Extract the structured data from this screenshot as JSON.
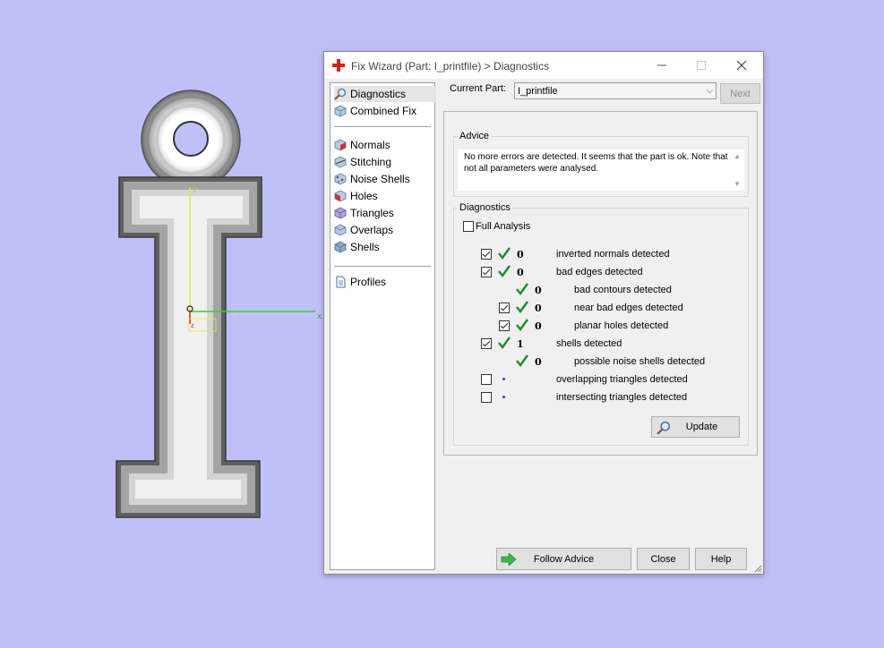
{
  "window": {
    "title": "Fix Wizard (Part: I_printfile) > Diagnostics",
    "minimize_icon": "minimize-icon",
    "maximize_icon": "maximize-icon",
    "close_icon": "close-icon"
  },
  "sidebar": {
    "items": [
      {
        "label": "Diagnostics",
        "icon": "magnifier-icon",
        "selected": true
      },
      {
        "label": "Combined Fix",
        "icon": "cube-icon"
      },
      {
        "label": "Normals",
        "icon": "normals-cube-icon"
      },
      {
        "label": "Stitching",
        "icon": "stitching-cube-icon"
      },
      {
        "label": "Noise Shells",
        "icon": "noise-shells-icon"
      },
      {
        "label": "Holes",
        "icon": "holes-cube-icon"
      },
      {
        "label": "Triangles",
        "icon": "triangles-cube-icon"
      },
      {
        "label": "Overlaps",
        "icon": "overlaps-cube-icon"
      },
      {
        "label": "Shells",
        "icon": "shells-icon"
      },
      {
        "label": "Profiles",
        "icon": "document-icon"
      }
    ]
  },
  "current_part": {
    "label": "Current Part:",
    "value": "I_printfile"
  },
  "buttons": {
    "next": "Next",
    "update": "Update",
    "follow_advice": "Follow Advice",
    "close": "Close",
    "help": "Help"
  },
  "advice": {
    "title": "Advice",
    "text": "No more errors are detected. It seems that the part is ok. Note that not all parameters were analysed."
  },
  "diagnostics": {
    "title": "Diagnostics",
    "full_analysis_label": "Full Analysis",
    "full_analysis_checked": false,
    "rows": [
      {
        "count": "0",
        "text": "inverted normals detected",
        "checked": true,
        "status": "ok"
      },
      {
        "count": "0",
        "text": "bad edges detected",
        "checked": true,
        "status": "ok"
      },
      {
        "count": "0",
        "text": "bad contours detected",
        "status": "ok"
      },
      {
        "count": "0",
        "text": "near bad edges detected",
        "checked": true,
        "status": "ok"
      },
      {
        "count": "0",
        "text": "planar holes detected",
        "checked": true,
        "status": "ok"
      },
      {
        "count": "1",
        "text": "shells detected",
        "checked": true,
        "status": "ok"
      },
      {
        "count": "0",
        "text": "possible noise shells detected",
        "status": "ok"
      },
      {
        "count": "",
        "text": "overlapping triangles detected",
        "checked": false,
        "status": "not-analysed"
      },
      {
        "count": "",
        "text": "intersecting triangles detected",
        "checked": false,
        "status": "not-analysed"
      }
    ]
  },
  "colors": {
    "background": "#c0c0f9",
    "ok_tick": "#1e8a2e",
    "axis_x": "#2fd32f",
    "axis_y": "#e8e84a"
  }
}
